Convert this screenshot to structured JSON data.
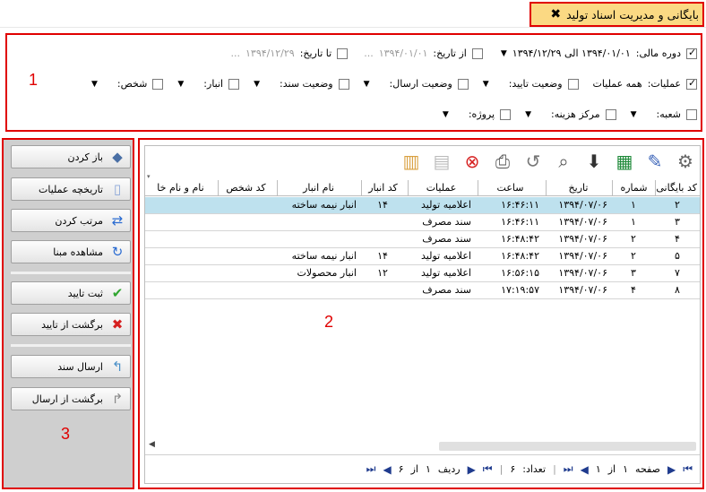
{
  "tab": {
    "title": "بایگانی و مدیریت اسناد تولید",
    "close": "✖"
  },
  "filters": {
    "fiscal_label": "دوره مالی:",
    "fiscal_value": "۱۳۹۴/۰۱/۰۱ الی ۱۳۹۴/۱۲/۲۹",
    "from_label": "از تاریخ:",
    "from_value": "۱۳۹۴/۰۱/۰۱",
    "to_label": "تا تاریخ:",
    "to_value": "۱۳۹۴/۱۲/۲۹",
    "ops_label": "عملیات:",
    "ops_value": "همه عملیات",
    "confirm_label": "وضعیت تایید:",
    "send_label": "وضعیت ارسال:",
    "doc_label": "وضعیت سند:",
    "warehouse_label": "انبار:",
    "person_label": "شخص:",
    "branch_label": "شعبه:",
    "cost_label": "مرکز هزینه:",
    "project_label": "پروژه:",
    "ellipsis": "..."
  },
  "labels": {
    "one": "1",
    "two": "2",
    "three": "3"
  },
  "sidebar": {
    "open": "باز کردن",
    "history": "تاریخچه عملیات",
    "sort": "مرتب کردن",
    "view_base": "مشاهده مبنا",
    "confirm": "ثبت تایید",
    "unconfirm": "برگشت از تایید",
    "send": "ارسال سند",
    "unsend": "برگشت از ارسال"
  },
  "table": {
    "headers": [
      "کد بایگانی",
      "شماره",
      "تاریخ",
      "ساعت",
      "عملیات",
      "کد انبار",
      "نام انبار",
      "کد شخص",
      "نام و نام خا"
    ],
    "rows": [
      [
        "۲",
        "۱",
        "۱۳۹۴/۰۷/۰۶",
        "۱۶:۴۶:۱۱",
        "اعلامیه تولید",
        "۱۴",
        "انبار نیمه ساخته",
        "",
        ""
      ],
      [
        "۳",
        "۱",
        "۱۳۹۴/۰۷/۰۶",
        "۱۶:۴۶:۱۱",
        "سند مصرف",
        "",
        "",
        "",
        ""
      ],
      [
        "۴",
        "۲",
        "۱۳۹۴/۰۷/۰۶",
        "۱۶:۴۸:۴۲",
        "سند مصرف",
        "",
        "",
        "",
        ""
      ],
      [
        "۵",
        "۲",
        "۱۳۹۴/۰۷/۰۶",
        "۱۶:۴۸:۴۲",
        "اعلامیه تولید",
        "۱۴",
        "انبار نیمه ساخته",
        "",
        ""
      ],
      [
        "۷",
        "۳",
        "۱۳۹۴/۰۷/۰۶",
        "۱۶:۵۶:۱۵",
        "اعلامیه تولید",
        "۱۲",
        "انبار محصولات",
        "",
        ""
      ],
      [
        "۸",
        "۴",
        "۱۳۹۴/۰۷/۰۶",
        "۱۷:۱۹:۵۷",
        "سند مصرف",
        "",
        "",
        "",
        ""
      ]
    ]
  },
  "pager": {
    "page_word": "صفحه",
    "page_value": "۱",
    "of_word": "از",
    "page_total": "۱",
    "count_label": "تعداد:",
    "count_value": "۶",
    "row_word": "ردیف",
    "row_value": "۱",
    "row_total": "۶"
  },
  "colors": {
    "accent_red": "#e00000",
    "tab_bg": "#fbd983",
    "selected_row": "#bee1ee"
  }
}
